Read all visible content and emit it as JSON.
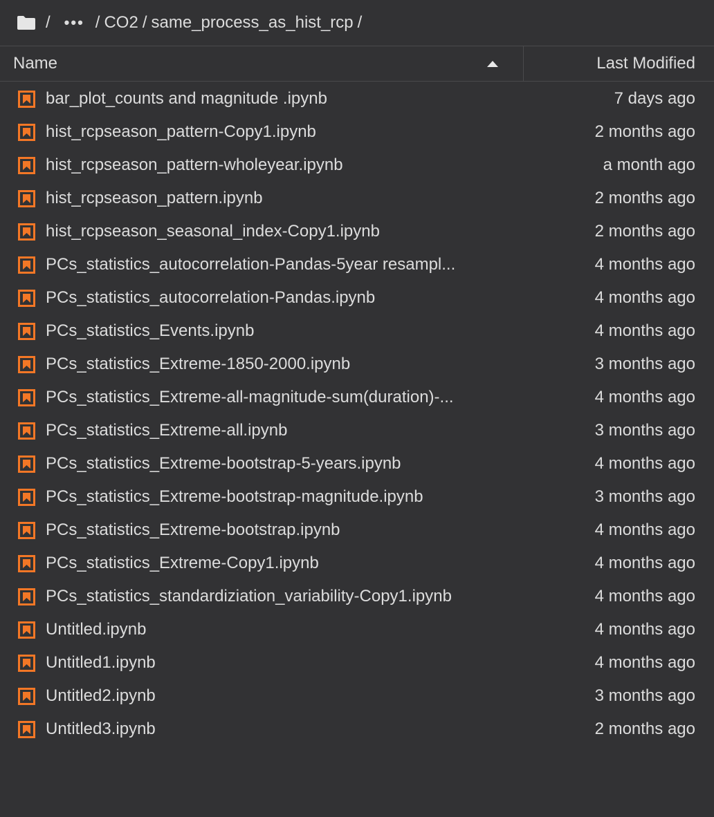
{
  "breadcrumb": {
    "root_sep": "/",
    "ellipsis": "•••",
    "items": [
      "CO2",
      "same_process_as_hist_rcp"
    ],
    "sep": "/"
  },
  "columns": {
    "name": "Name",
    "modified": "Last Modified"
  },
  "colors": {
    "notebook_icon": "#f37726",
    "background": "#323234",
    "text": "#dcdcdc"
  },
  "files": [
    {
      "name": "bar_plot_counts and magnitude .ipynb",
      "modified": "7 days ago",
      "icon": "notebook-icon"
    },
    {
      "name": "hist_rcpseason_pattern-Copy1.ipynb",
      "modified": "2 months ago",
      "icon": "notebook-icon"
    },
    {
      "name": "hist_rcpseason_pattern-wholeyear.ipynb",
      "modified": "a month ago",
      "icon": "notebook-icon"
    },
    {
      "name": "hist_rcpseason_pattern.ipynb",
      "modified": "2 months ago",
      "icon": "notebook-icon"
    },
    {
      "name": "hist_rcpseason_seasonal_index-Copy1.ipynb",
      "modified": "2 months ago",
      "icon": "notebook-icon"
    },
    {
      "name": "PCs_statistics_autocorrelation-Pandas-5year resampl...",
      "modified": "4 months ago",
      "icon": "notebook-icon"
    },
    {
      "name": "PCs_statistics_autocorrelation-Pandas.ipynb",
      "modified": "4 months ago",
      "icon": "notebook-icon"
    },
    {
      "name": "PCs_statistics_Events.ipynb",
      "modified": "4 months ago",
      "icon": "notebook-icon"
    },
    {
      "name": "PCs_statistics_Extreme-1850-2000.ipynb",
      "modified": "3 months ago",
      "icon": "notebook-icon"
    },
    {
      "name": "PCs_statistics_Extreme-all-magnitude-sum(duration)-...",
      "modified": "4 months ago",
      "icon": "notebook-icon"
    },
    {
      "name": "PCs_statistics_Extreme-all.ipynb",
      "modified": "3 months ago",
      "icon": "notebook-icon"
    },
    {
      "name": "PCs_statistics_Extreme-bootstrap-5-years.ipynb",
      "modified": "4 months ago",
      "icon": "notebook-icon"
    },
    {
      "name": "PCs_statistics_Extreme-bootstrap-magnitude.ipynb",
      "modified": "3 months ago",
      "icon": "notebook-icon"
    },
    {
      "name": "PCs_statistics_Extreme-bootstrap.ipynb",
      "modified": "4 months ago",
      "icon": "notebook-icon"
    },
    {
      "name": "PCs_statistics_Extreme-Copy1.ipynb",
      "modified": "4 months ago",
      "icon": "notebook-icon"
    },
    {
      "name": "PCs_statistics_standardiziation_variability-Copy1.ipynb",
      "modified": "4 months ago",
      "icon": "notebook-icon"
    },
    {
      "name": "Untitled.ipynb",
      "modified": "4 months ago",
      "icon": "notebook-icon"
    },
    {
      "name": "Untitled1.ipynb",
      "modified": "4 months ago",
      "icon": "notebook-icon"
    },
    {
      "name": "Untitled2.ipynb",
      "modified": "3 months ago",
      "icon": "notebook-icon"
    },
    {
      "name": "Untitled3.ipynb",
      "modified": "2 months ago",
      "icon": "notebook-icon"
    }
  ]
}
